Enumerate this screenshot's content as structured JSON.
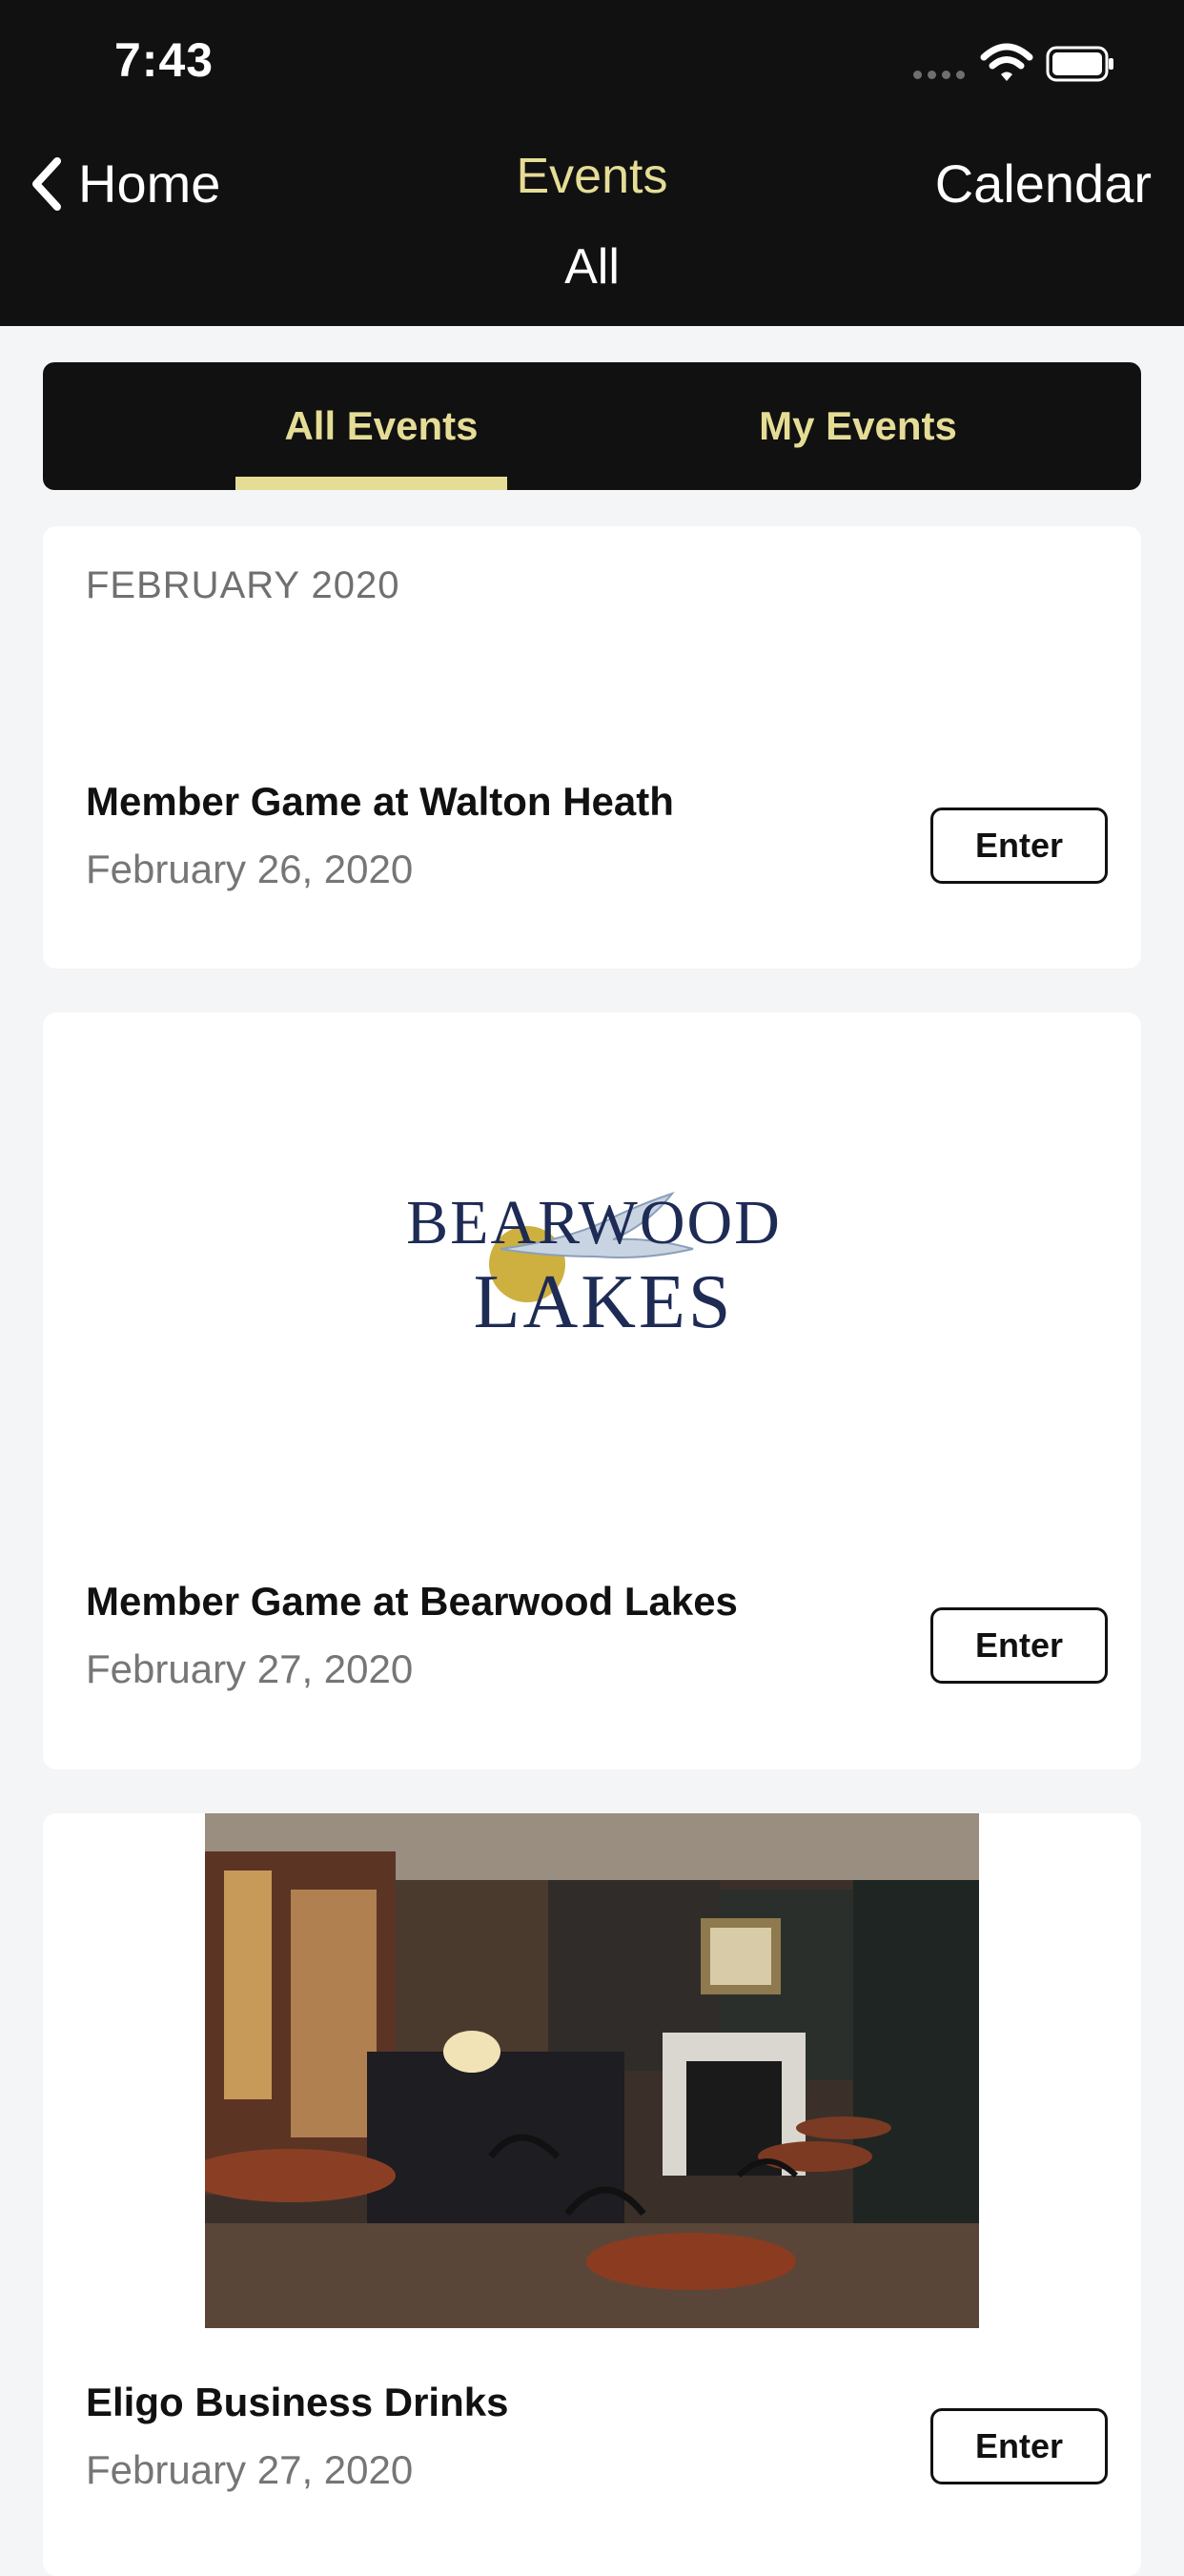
{
  "status": {
    "time": "7:43"
  },
  "nav": {
    "back_label": "Home",
    "title": "Events",
    "subtitle": "All",
    "right_label": "Calendar"
  },
  "tabs": [
    {
      "label": "All Events",
      "active": true
    },
    {
      "label": "My Events",
      "active": false
    }
  ],
  "month_header": "FEBRUARY 2020",
  "events": [
    {
      "title": "Member Game at Walton Heath",
      "date": "February 26, 2020",
      "action": "Enter"
    },
    {
      "title": "Member Game at Bearwood Lakes",
      "date": "February 27, 2020",
      "action": "Enter",
      "logo_text": {
        "top": "BEARWOOD",
        "bottom": "LAKES"
      }
    },
    {
      "title": "Eligo Business Drinks",
      "date": "February 27, 2020",
      "action": "Enter"
    }
  ],
  "colors": {
    "header_bg": "#111111",
    "accent": "#e5dd96",
    "background": "#f4f5f7"
  }
}
